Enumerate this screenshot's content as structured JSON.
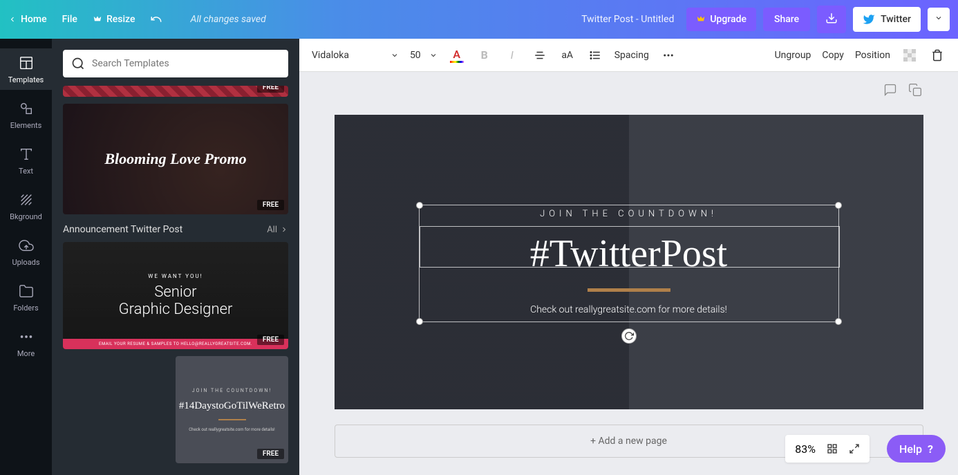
{
  "topbar": {
    "home": "Home",
    "file": "File",
    "resize": "Resize",
    "saved_status": "All changes saved",
    "doc_title": "Twitter Post - Untitled",
    "upgrade": "Upgrade",
    "share": "Share",
    "publish_target": "Twitter"
  },
  "rail": {
    "templates": "Templates",
    "elements": "Elements",
    "text": "Text",
    "bkground": "Bkground",
    "uploads": "Uploads",
    "folders": "Folders",
    "more": "More"
  },
  "side": {
    "search_placeholder": "Search Templates",
    "free_badge": "FREE",
    "template1_title": "Blooming Love Promo",
    "section_title": "Announcement Twitter Post",
    "all_label": "All",
    "template2_eyebrow": "WE WANT YOU!",
    "template2_title_a": "Senior",
    "template2_title_b": "Graphic Designer",
    "template2_footer": "EMAIL YOUR RESUME & SAMPLES TO HELLO@REALLYGREATSITE.COM.",
    "template3_eyebrow": "JOIN THE COUNTDOWN!",
    "template3_title": "#14DaystoGoTilWeRetro",
    "template3_sub": "Check out reallygreatsite.com for more details!"
  },
  "toolbar": {
    "font": "Vidaloka",
    "size": "50",
    "spacing": "Spacing",
    "ungroup": "Ungroup",
    "copy": "Copy",
    "position": "Position"
  },
  "canvas": {
    "eyebrow": "JOIN THE COUNTDOWN!",
    "headline": "#TwitterPost",
    "subline": "Check out reallygreatsite.com for more details!",
    "add_page": "+ Add a new page"
  },
  "footer": {
    "zoom": "83%",
    "help": "Help"
  }
}
